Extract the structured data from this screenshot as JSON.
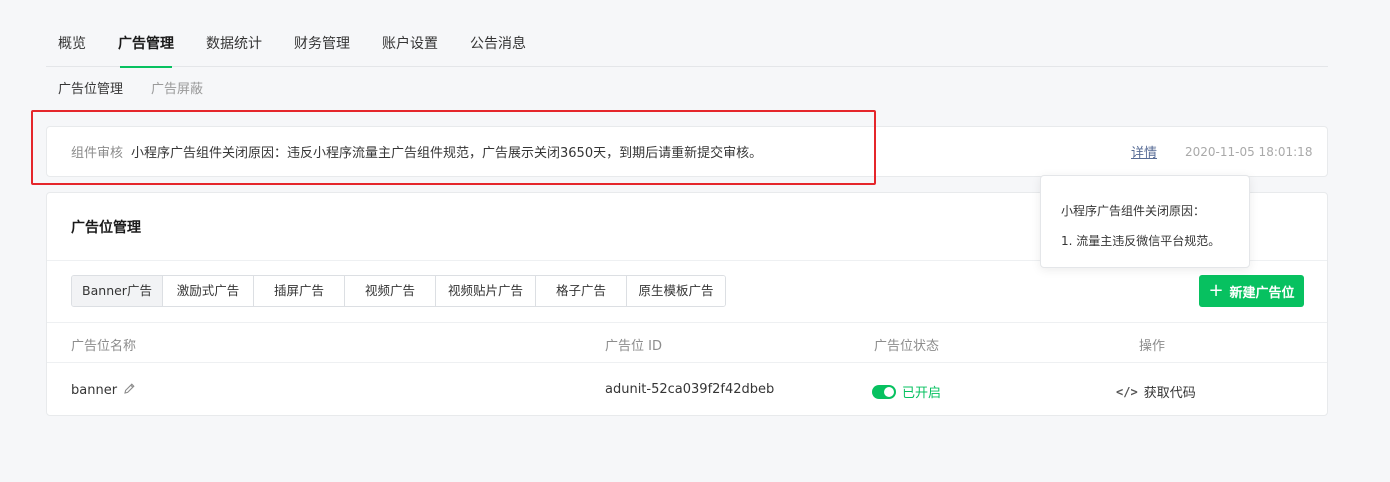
{
  "top_nav": [
    "概览",
    "广告管理",
    "数据统计",
    "财务管理",
    "账户设置",
    "公告消息"
  ],
  "top_nav_active": 1,
  "sub_nav": [
    "广告位管理",
    "广告屏蔽"
  ],
  "notice": {
    "label": "组件审核",
    "message": "小程序广告组件关闭原因：违反小程序流量主广告组件规范，广告展示关闭3650天，到期后请重新提交审核。",
    "detail_link": "详情",
    "time": "2020-11-05 18:01:18"
  },
  "popover": {
    "title": "小程序广告组件关闭原因：",
    "item": "1. 流量主违反微信平台规范。"
  },
  "card": {
    "title": "广告位管理",
    "tabs": [
      "Banner广告",
      "激励式广告",
      "插屏广告",
      "视频广告",
      "视频贴片广告",
      "格子广告",
      "原生模板广告"
    ],
    "active_tab": 0,
    "new_button": "新建广告位",
    "table": {
      "headers": [
        "广告位名称",
        "广告位 ID",
        "广告位状态",
        "操作"
      ],
      "rows": [
        {
          "name": "banner",
          "id": "adunit-52ca039f2f42dbeb",
          "status": "已开启",
          "action": "获取代码"
        }
      ]
    }
  },
  "colors": {
    "accent": "#07c160",
    "link": "#576b95",
    "highlight_box": "#e5262b"
  },
  "icons": {
    "edit": "pencil-icon",
    "code": "code-icon",
    "add": "plus-icon"
  }
}
